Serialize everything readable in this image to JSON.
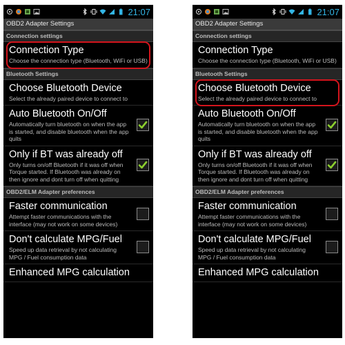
{
  "screens": [
    {
      "status": {
        "time": "21:07"
      },
      "app_title": "OBD2 Adapter Settings",
      "highlighted": "connection-type",
      "sections": [
        {
          "header": "Connection settings",
          "items": [
            {
              "key": "connection-type",
              "title": "Connection Type",
              "summary": "Choose the connection type (Bluetooth, WiFi or USB)",
              "checkbox": null
            }
          ]
        },
        {
          "header": "Bluetooth Settings",
          "items": [
            {
              "key": "choose-bluetooth-device",
              "title": "Choose Bluetooth Device",
              "summary": "Select the already paired device to connect to",
              "checkbox": null
            },
            {
              "key": "auto-bluetooth",
              "title": "Auto Bluetooth On/Off",
              "summary": "Automatically turn bluetooth on when the app is started, and disable bluetooth when the app quits",
              "checkbox": true
            },
            {
              "key": "only-if-bt-off",
              "title": "Only if BT was already off",
              "summary": "Only turns on/off Bluetooth if it was off when Torque started. If Bluetooth was already on then ignore and dont turn off when quitting",
              "checkbox": true
            }
          ]
        },
        {
          "header": "OBD2/ELM Adapter preferences",
          "items": [
            {
              "key": "faster-communication",
              "title": "Faster communication",
              "summary": "Attempt faster communications with the interface (may not work on some devices)",
              "checkbox": false
            },
            {
              "key": "dont-calculate-mpg",
              "title": "Don't calculate MPG/Fuel",
              "summary": "Speed up data retrieval by not calculating MPG / Fuel consumption data",
              "checkbox": false
            },
            {
              "key": "enhanced-mpg",
              "title": "Enhanced MPG calculation",
              "summary": "",
              "checkbox": null
            }
          ]
        }
      ]
    },
    {
      "status": {
        "time": "21:07"
      },
      "app_title": "OBD2 Adapter Settings",
      "highlighted": "choose-bluetooth-device",
      "sections": [
        {
          "header": "Connection settings",
          "items": [
            {
              "key": "connection-type",
              "title": "Connection Type",
              "summary": "Choose the connection type (Bluetooth, WiFi or USB)",
              "checkbox": null
            }
          ]
        },
        {
          "header": "Bluetooth Settings",
          "items": [
            {
              "key": "choose-bluetooth-device",
              "title": "Choose Bluetooth Device",
              "summary": "Select the already paired device to connect to",
              "checkbox": null
            },
            {
              "key": "auto-bluetooth",
              "title": "Auto Bluetooth On/Off",
              "summary": "Automatically turn bluetooth on when the app is started, and disable bluetooth when the app quits",
              "checkbox": true
            },
            {
              "key": "only-if-bt-off",
              "title": "Only if BT was already off",
              "summary": "Only turns on/off Bluetooth if it was off when Torque started. If Bluetooth was already on then ignore and dont turn off when quitting",
              "checkbox": true
            }
          ]
        },
        {
          "header": "OBD2/ELM Adapter preferences",
          "items": [
            {
              "key": "faster-communication",
              "title": "Faster communication",
              "summary": "Attempt faster communications with the interface (may not work on some devices)",
              "checkbox": false
            },
            {
              "key": "dont-calculate-mpg",
              "title": "Don't calculate MPG/Fuel",
              "summary": "Speed up data retrieval by not calculating MPG / Fuel consumption data",
              "checkbox": false
            },
            {
              "key": "enhanced-mpg",
              "title": "Enhanced MPG calculation",
              "summary": "",
              "checkbox": null
            }
          ]
        }
      ]
    }
  ],
  "colors": {
    "highlight": "#d4141c",
    "check": "#8ccf2e",
    "clock": "#33b5e5"
  }
}
